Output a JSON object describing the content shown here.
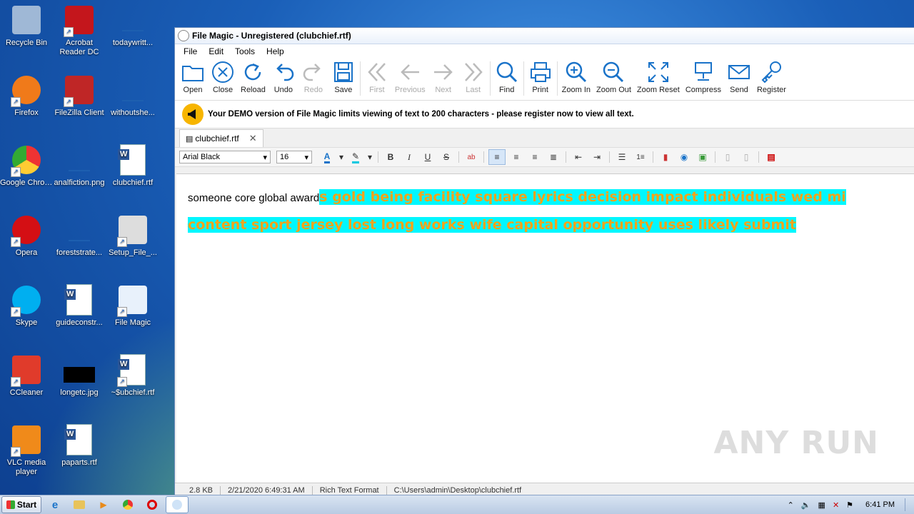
{
  "desktop": {
    "icons": [
      {
        "label": "Recycle Bin",
        "icon": "recycle-bin-icon"
      },
      {
        "label": "Acrobat Reader DC",
        "icon": "acrobat-icon"
      },
      {
        "label": "todaywritt...",
        "icon": "blank-file-icon"
      },
      {
        "label": "Firefox",
        "icon": "firefox-icon"
      },
      {
        "label": "FileZilla Client",
        "icon": "filezilla-icon"
      },
      {
        "label": "withoutshe...",
        "icon": "blank-file-icon"
      },
      {
        "label": "Google Chrome",
        "icon": "chrome-icon"
      },
      {
        "label": "analfiction.png",
        "icon": "blank-file-icon"
      },
      {
        "label": "clubchief.rtf",
        "icon": "word-doc-icon"
      },
      {
        "label": "Opera",
        "icon": "opera-icon"
      },
      {
        "label": "foreststrate...",
        "icon": "blank-file-icon"
      },
      {
        "label": "Setup_File_...",
        "icon": "setup-icon"
      },
      {
        "label": "Skype",
        "icon": "skype-icon"
      },
      {
        "label": "guideconstr...",
        "icon": "word-doc-icon"
      },
      {
        "label": "File Magic",
        "icon": "file-magic-icon"
      },
      {
        "label": "CCleaner",
        "icon": "ccleaner-icon"
      },
      {
        "label": "longetc.jpg",
        "icon": "black-image-icon"
      },
      {
        "label": "~$ubchief.rtf",
        "icon": "word-doc-icon"
      },
      {
        "label": "VLC media player",
        "icon": "vlc-icon"
      },
      {
        "label": "paparts.rtf",
        "icon": "word-doc-icon"
      }
    ]
  },
  "window": {
    "title": "File Magic - Unregistered (clubchief.rtf)",
    "menu": [
      "File",
      "Edit",
      "Tools",
      "Help"
    ],
    "toolbar": {
      "open": "Open",
      "close": "Close",
      "reload": "Reload",
      "undo": "Undo",
      "redo": "Redo",
      "save": "Save",
      "first": "First",
      "previous": "Previous",
      "next": "Next",
      "last": "Last",
      "find": "Find",
      "print": "Print",
      "zoom_in": "Zoom In",
      "zoom_out": "Zoom Out",
      "zoom_reset": "Zoom Reset",
      "compress": "Compress",
      "send": "Send",
      "register": "Register"
    },
    "demo_notice": "Your DEMO version of File Magic limits viewing of text to 200 characters - please register now to view all text.",
    "tab": {
      "label": "clubchief.rtf"
    },
    "format": {
      "font": "Arial Black",
      "size": "16"
    },
    "document": {
      "plain": "someone core  global award",
      "highlighted": "s gold  being facility square lyrics decision  impact individuals  wed  mi content sport jersey lost long   works wife  capital opportunity uses likely   submit"
    },
    "status": {
      "size": "2.8 KB",
      "date": "2/21/2020 6:49:31 AM",
      "format": "Rich Text Format",
      "path": "C:\\Users\\admin\\Desktop\\clubchief.rtf"
    },
    "watermark": "ANY RUN"
  },
  "taskbar": {
    "start": "Start",
    "clock": "6:41 PM"
  },
  "colors": {
    "highlight_bg": "#00f7ff",
    "highlight_fg": "#f5a31a",
    "accent": "#1a73c9"
  }
}
